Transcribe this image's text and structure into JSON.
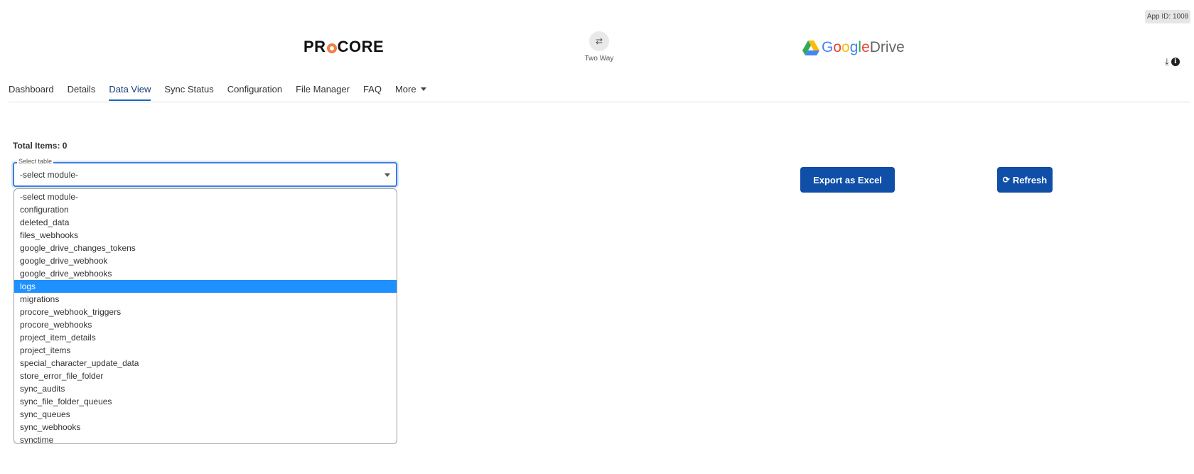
{
  "app_id": "App ID: 1008",
  "brand": {
    "procore_logo": "PROCORE",
    "sync_icon": "swap-arrows",
    "sync_label": "Two Way",
    "gdrive_logo_google": "Google",
    "gdrive_logo_drive": "Drive"
  },
  "tabs": [
    {
      "label": "Dashboard"
    },
    {
      "label": "Details"
    },
    {
      "label": "Data View"
    },
    {
      "label": "Sync Status"
    },
    {
      "label": "Configuration"
    },
    {
      "label": "File Manager"
    },
    {
      "label": "FAQ"
    },
    {
      "label": "More"
    }
  ],
  "total_items": "Total Items: 0",
  "select": {
    "legend": "Select table",
    "value": "-select module-"
  },
  "dropdown_options": [
    "-select module-",
    "configuration",
    "deleted_data",
    "files_webhooks",
    "google_drive_changes_tokens",
    "google_drive_webhook",
    "google_drive_webhooks",
    "logs",
    "migrations",
    "procore_webhook_triggers",
    "procore_webhooks",
    "project_item_details",
    "project_items",
    "special_character_update_data",
    "store_error_file_folder",
    "sync_audits",
    "sync_file_folder_queues",
    "sync_queues",
    "sync_webhooks",
    "synctime"
  ],
  "highlighted_option": "logs",
  "buttons": {
    "export": "Export as Excel",
    "refresh": "Refresh"
  },
  "colors": {
    "primary_button": "#0f4fa8",
    "highlight": "#1e90ff",
    "procore_accent": "#f47e42"
  }
}
